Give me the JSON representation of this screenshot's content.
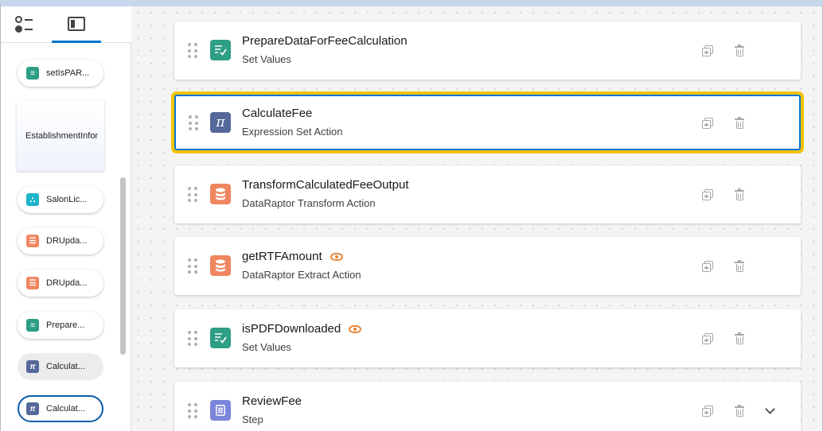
{
  "colors": {
    "set_values": "#2e9e84",
    "expression_set": "#55689a",
    "dataraptor": "#f08660",
    "step": "#7b85d9",
    "highlight_outline": "#f2c200",
    "selection_blue": "#0176d3",
    "preview_eye": "#e8863a"
  },
  "left_panel": {
    "tabs": [
      {
        "icon": "tree-view-icon",
        "active": false
      },
      {
        "icon": "panel-layout-icon",
        "active": true
      }
    ],
    "items": [
      {
        "label": "setIsPAR...",
        "icon": "set-values-icon",
        "color": "#2e9e84",
        "glyph": "≡✓"
      },
      {
        "label": "EstablishmentInfor"
      },
      {
        "label": "SalonLic...",
        "icon": "integration-procedure-icon",
        "color": "#1eb5c9",
        "glyph": "⛬"
      },
      {
        "label": "DRUpda...",
        "icon": "dataraptor-icon",
        "color": "#f08660",
        "glyph": "☰"
      },
      {
        "label": "DRUpda...",
        "icon": "dataraptor-icon",
        "color": "#f08660",
        "glyph": "☰"
      },
      {
        "label": "Prepare...",
        "icon": "set-values-icon",
        "color": "#2e9e84",
        "glyph": "≡✓"
      },
      {
        "label": "Calculat...",
        "icon": "pi-icon",
        "color": "#55689a",
        "glyph": "π"
      },
      {
        "label": "Calculat...",
        "icon": "pi-icon",
        "color": "#55689a",
        "glyph": "π"
      }
    ]
  },
  "cards": [
    {
      "title": "PrepareDataForFeeCalculation",
      "subtitle": "Set Values",
      "color": "#2e9e84",
      "glyph": "≡✓",
      "eye": false
    },
    {
      "title": "CalculateFee",
      "subtitle": "Expression Set Action",
      "color": "#55689a",
      "glyph": "π",
      "eye": false
    },
    {
      "title": "TransformCalculatedFeeOutput",
      "subtitle": "DataRaptor Transform Action",
      "color": "#f08660",
      "glyph": "☰",
      "eye": false
    },
    {
      "title": "getRTFAmount",
      "subtitle": "DataRaptor Extract Action",
      "color": "#f08660",
      "glyph": "☰",
      "eye": true
    },
    {
      "title": "isPDFDownloaded",
      "subtitle": "Set Values",
      "color": "#2e9e84",
      "glyph": "≡✓",
      "eye": true
    },
    {
      "title": "ReviewFee",
      "subtitle": "Step",
      "color": "#7b85d9",
      "glyph": "▤",
      "eye": false
    }
  ]
}
